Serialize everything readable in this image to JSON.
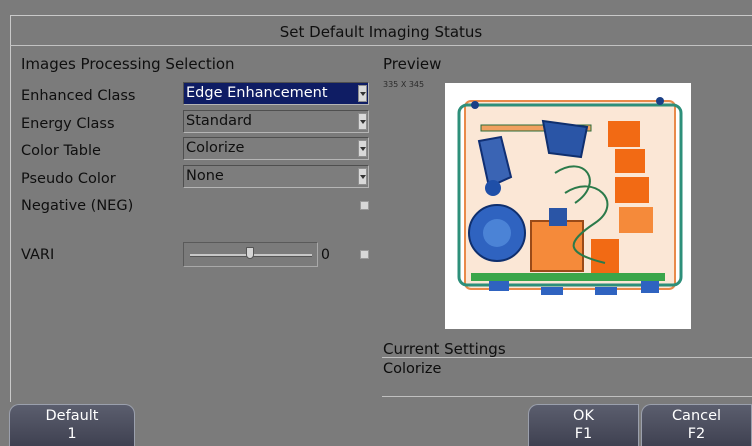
{
  "dialog": {
    "title": "Set Default Imaging Status"
  },
  "processing": {
    "heading": "Images Processing Selection",
    "rows": [
      {
        "label": "Enhanced Class",
        "value": "Edge Enhancement",
        "selected": true
      },
      {
        "label": "Energy Class",
        "value": "Standard"
      },
      {
        "label": "Color Table",
        "value": "Colorize"
      },
      {
        "label": "Pseudo Color",
        "value": "None"
      }
    ],
    "negative": {
      "label": "Negative (NEG)",
      "checked": false
    },
    "vari": {
      "label": "VARI",
      "value": "0",
      "level": 0.5,
      "checked": false
    }
  },
  "preview": {
    "heading": "Preview",
    "dimensions": "335 X 345",
    "image_description": "x-ray-scan-of-luggage"
  },
  "current_settings": {
    "heading": "Current Settings",
    "value": "Colorize"
  },
  "function_keys": {
    "default": {
      "label": "Default",
      "key": "1"
    },
    "ok": {
      "label": "OK",
      "key": "F1"
    },
    "cancel": {
      "label": "Cancel",
      "key": "F2"
    }
  },
  "colors": {
    "background": "#7b7b7b",
    "selected_combo": "#0f1d64",
    "button": "#4c4f5f",
    "xray_orange": "#f26a14",
    "xray_blue": "#1f4fa8",
    "xray_green": "#3a9a3a"
  }
}
